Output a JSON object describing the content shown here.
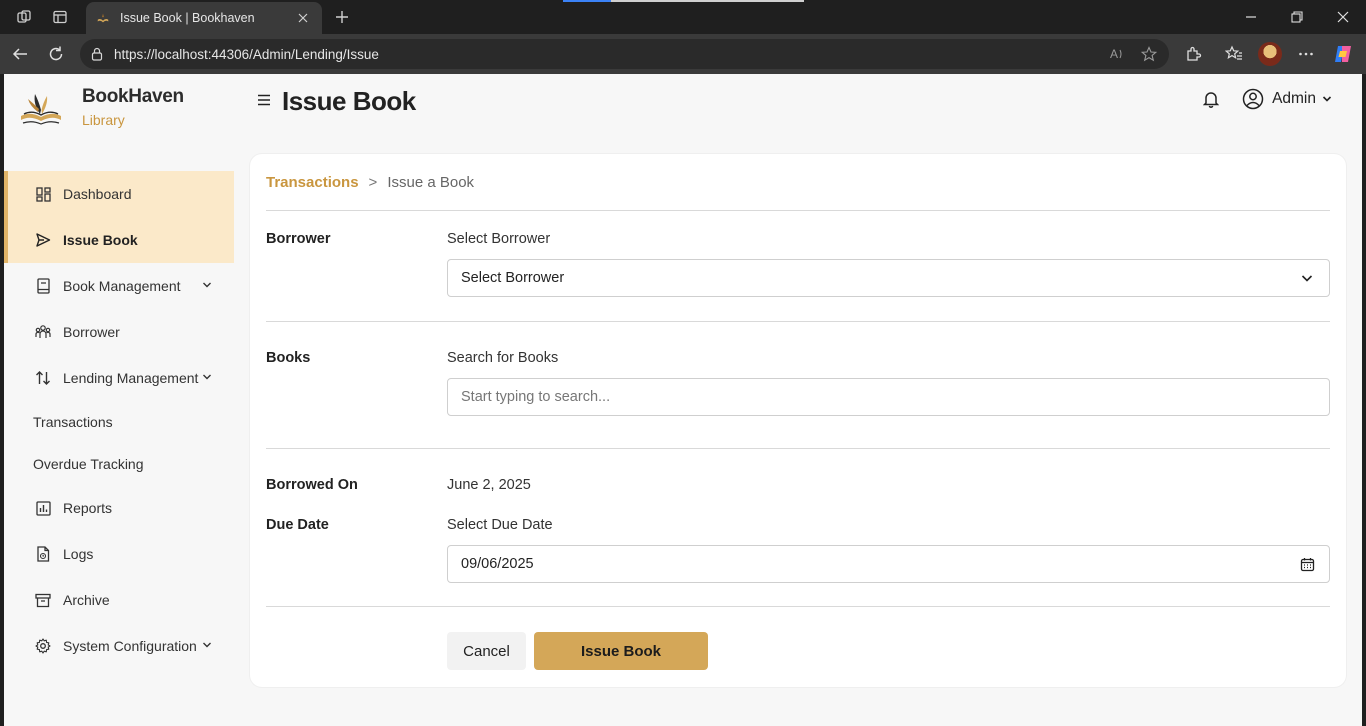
{
  "browser": {
    "tab_title": "Issue Book | Bookhaven",
    "url": "https://localhost:44306/Admin/Lending/Issue"
  },
  "brand": {
    "name": "BookHaven",
    "subtitle": "Library",
    "accent_color": "#c9963f"
  },
  "header": {
    "menu_icon": "hamburger-icon",
    "title": "Issue Book",
    "user_label": "Admin"
  },
  "sidebar": {
    "items": [
      {
        "label": "Dashboard",
        "icon": "dashboard-icon"
      },
      {
        "label": "Issue Book",
        "icon": "send-icon"
      },
      {
        "label": "Book Management",
        "icon": "book-icon"
      },
      {
        "label": "Borrower",
        "icon": "people-icon"
      },
      {
        "label": "Lending Management",
        "icon": "swap-icon"
      },
      {
        "label": "Transactions"
      },
      {
        "label": "Overdue Tracking"
      },
      {
        "label": "Reports",
        "icon": "chart-icon"
      },
      {
        "label": "Logs",
        "icon": "log-icon"
      },
      {
        "label": "Archive",
        "icon": "archive-icon"
      },
      {
        "label": "System Configuration",
        "icon": "gear-icon"
      }
    ]
  },
  "breadcrumb": {
    "parent": "Transactions",
    "separator": ">",
    "current": "Issue a Book"
  },
  "form": {
    "borrower": {
      "row_label": "Borrower",
      "field_label": "Select Borrower",
      "selected": "Select Borrower"
    },
    "books": {
      "row_label": "Books",
      "field_label": "Search for Books",
      "placeholder": "Start typing to search..."
    },
    "borrowed_on": {
      "row_label": "Borrowed On",
      "value": "June 2, 2025"
    },
    "due_date": {
      "row_label": "Due Date",
      "field_label": "Select Due Date",
      "value": "09/06/2025"
    },
    "cancel_label": "Cancel",
    "submit_label": "Issue Book",
    "submit_color": "#d4a758"
  }
}
